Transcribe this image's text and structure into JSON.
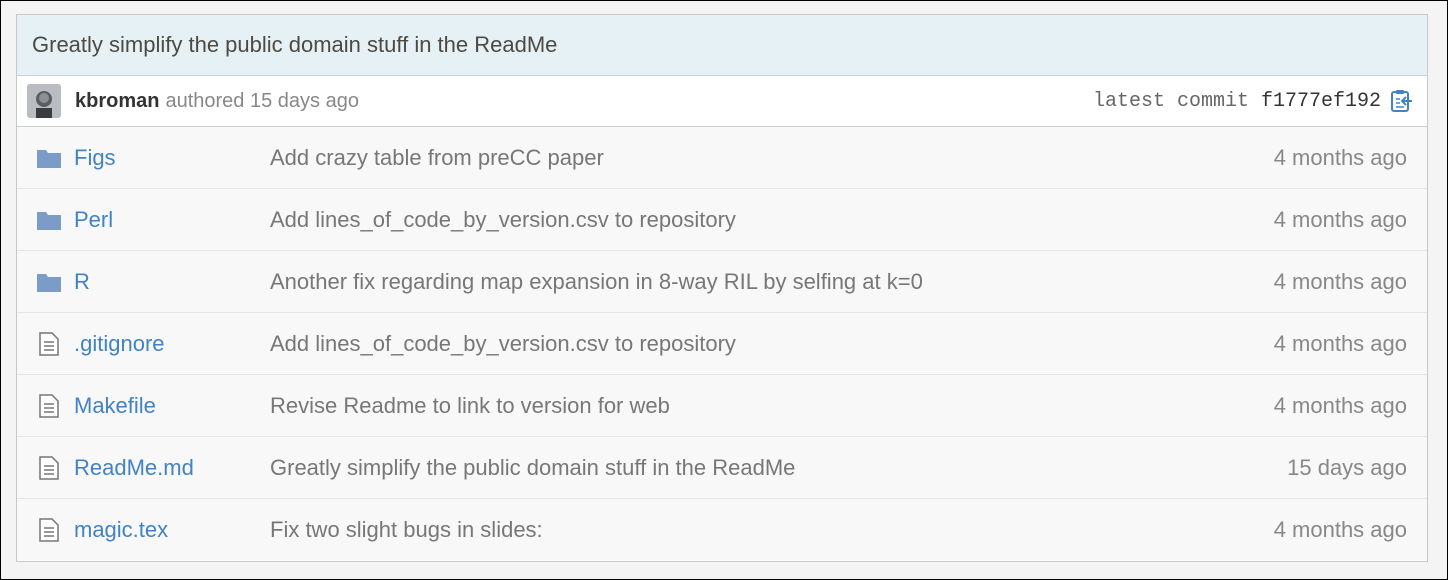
{
  "commit": {
    "message": "Greatly simplify the public domain stuff in the ReadMe",
    "author": "kbroman",
    "authored_text": "authored 15 days ago",
    "latest_label": "latest commit",
    "sha": "f1777ef192"
  },
  "files": [
    {
      "name": "Figs",
      "type": "folder-icon",
      "message": "Add crazy table from preCC paper",
      "age": "4 months ago"
    },
    {
      "name": "Perl",
      "type": "folder-icon",
      "message": "Add lines_of_code_by_version.csv to repository",
      "age": "4 months ago"
    },
    {
      "name": "R",
      "type": "folder-icon",
      "message": "Another fix regarding map expansion in 8-way RIL by selfing at k=0",
      "age": "4 months ago"
    },
    {
      "name": ".gitignore",
      "type": "file-icon",
      "message": "Add lines_of_code_by_version.csv to repository",
      "age": "4 months ago"
    },
    {
      "name": "Makefile",
      "type": "file-icon",
      "message": "Revise Readme to link to version for web",
      "age": "4 months ago"
    },
    {
      "name": "ReadMe.md",
      "type": "file-icon",
      "message": "Greatly simplify the public domain stuff in the ReadMe",
      "age": "15 days ago"
    },
    {
      "name": "magic.tex",
      "type": "file-icon",
      "message": "Fix two slight bugs in slides:",
      "age": "4 months ago"
    }
  ],
  "colors": {
    "link": "#4183c4",
    "folder": "#7a9cc6",
    "commit_bar": "#e6f1f6"
  }
}
